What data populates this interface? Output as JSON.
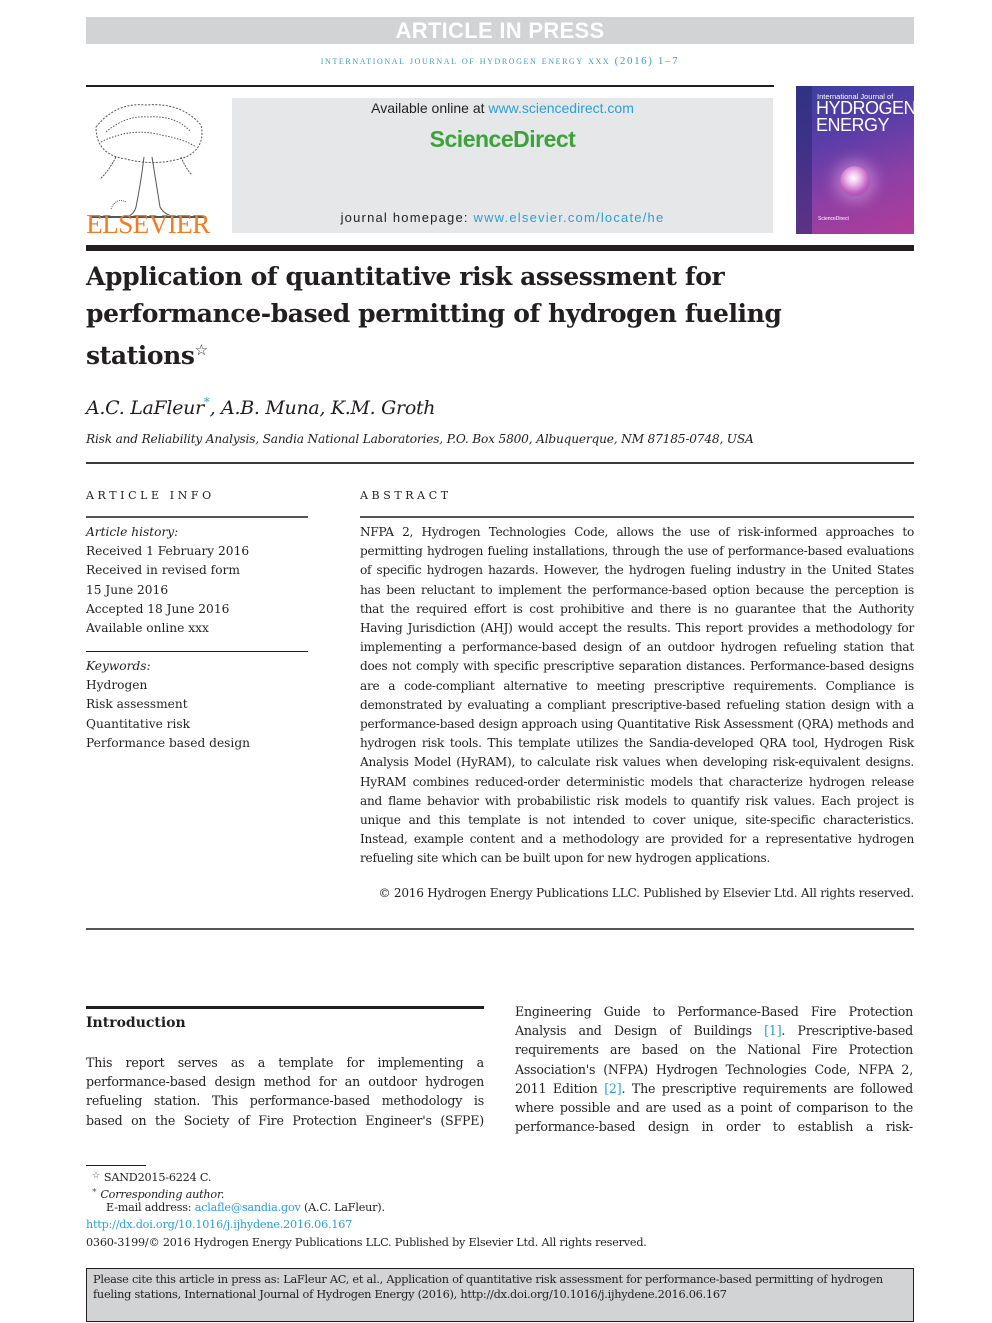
{
  "banner": {
    "text": "ARTICLE IN PRESS"
  },
  "journal_line": "international journal of hydrogen energy xxx (2016) 1–7",
  "header": {
    "publisher": "ELSEVIER",
    "available_prefix": "Available online at ",
    "available_link": "www.sciencedirect.com",
    "sciencedirect_logo": "ScienceDirect",
    "homepage_prefix": "journal homepage: ",
    "homepage_link": "www.elsevier.com/locate/he",
    "cover": {
      "line1": "International Journal of",
      "line2": "HYDROGEN",
      "line3": "ENERGY",
      "footer": "ScienceDirect"
    }
  },
  "article": {
    "title": "Application of quantitative risk assessment for performance-based permitting of hydrogen fueling stations",
    "title_note_mark": "☆",
    "authors": {
      "first": "A.C. LaFleur",
      "first_mark": "*",
      "rest": ", A.B. Muna, K.M. Groth"
    },
    "affiliation": "Risk and Reliability Analysis, Sandia National Laboratories, P.O. Box 5800, Albuquerque, NM 87185-0748, USA"
  },
  "article_info": {
    "heading": "ARTICLE INFO",
    "history_label": "Article history:",
    "history": [
      "Received 1 February 2016",
      "Received in revised form",
      "15 June 2016",
      "Accepted 18 June 2016",
      "Available online xxx"
    ],
    "keywords_label": "Keywords:",
    "keywords": [
      "Hydrogen",
      "Risk assessment",
      "Quantitative risk",
      "Performance based design"
    ]
  },
  "abstract": {
    "heading": "ABSTRACT",
    "text": "NFPA 2, Hydrogen Technologies Code, allows the use of risk-informed approaches to permitting hydrogen fueling installations, through the use of performance-based evaluations of specific hydrogen hazards. However, the hydrogen fueling industry in the United States has been reluctant to implement the performance-based option because the perception is that the required effort is cost prohibitive and there is no guarantee that the Authority Having Jurisdiction (AHJ) would accept the results. This report provides a methodology for implementing a performance-based design of an outdoor hydrogen refueling station that does not comply with specific prescriptive separation distances. Performance-based designs are a code-compliant alternative to meeting prescriptive requirements. Compliance is demonstrated by evaluating a compliant prescriptive-based refueling station design with a performance-based design approach using Quantitative Risk Assessment (QRA) methods and hydrogen risk tools. This template utilizes the Sandia-developed QRA tool, Hydrogen Risk Analysis Model (HyRAM), to calculate risk values when developing risk-equivalent designs. HyRAM combines reduced-order deterministic models that characterize hydrogen release and flame behavior with probabilistic risk models to quantify risk values. Each project is unique and this template is not intended to cover unique, site-specific characteristics. Instead, example content and a methodology are provided for a representative hydrogen refueling site which can be built upon for new hydrogen applications.",
    "copyright": "© 2016 Hydrogen Energy Publications LLC. Published by Elsevier Ltd. All rights reserved."
  },
  "introduction": {
    "heading": "Introduction",
    "left_text": "This report serves as a template for implementing a performance-based design method for an outdoor hydrogen refueling station. This performance-based methodology is based on the Society of Fire Protection Engineer's (SFPE)",
    "right_part1": "Engineering Guide to Performance-Based Fire Protection Analysis and Design of Buildings ",
    "ref1": "[1]",
    "right_part2": ". Prescriptive-based requirements are based on the National Fire Protection Association's (NFPA) Hydrogen Technologies Code, NFPA 2, 2011 Edition ",
    "ref2": "[2]",
    "right_part3": ". The prescriptive requirements are followed where possible and are used as a point of comparison to the performance-based design in order to establish a risk-"
  },
  "footnotes": {
    "note1_mark": "☆",
    "note1": "SAND2015-6224 C.",
    "note2_mark": "*",
    "note2": "Corresponding author.",
    "email_prefix": "E-mail address: ",
    "email": "aclafle@sandia.gov",
    "email_suffix": " (A.C. LaFleur).",
    "doi": "http://dx.doi.org/10.1016/j.ijhydene.2016.06.167",
    "issn_line": "0360-3199/© 2016 Hydrogen Energy Publications LLC. Published by Elsevier Ltd. All rights reserved."
  },
  "citation_box": {
    "text": "Please cite this article in press as: LaFleur AC, et al., Application of quantitative risk assessment for performance-based permitting of hydrogen fueling stations, International Journal of Hydrogen Energy (2016), http://dx.doi.org/10.1016/j.ijhydene.2016.06.167"
  }
}
